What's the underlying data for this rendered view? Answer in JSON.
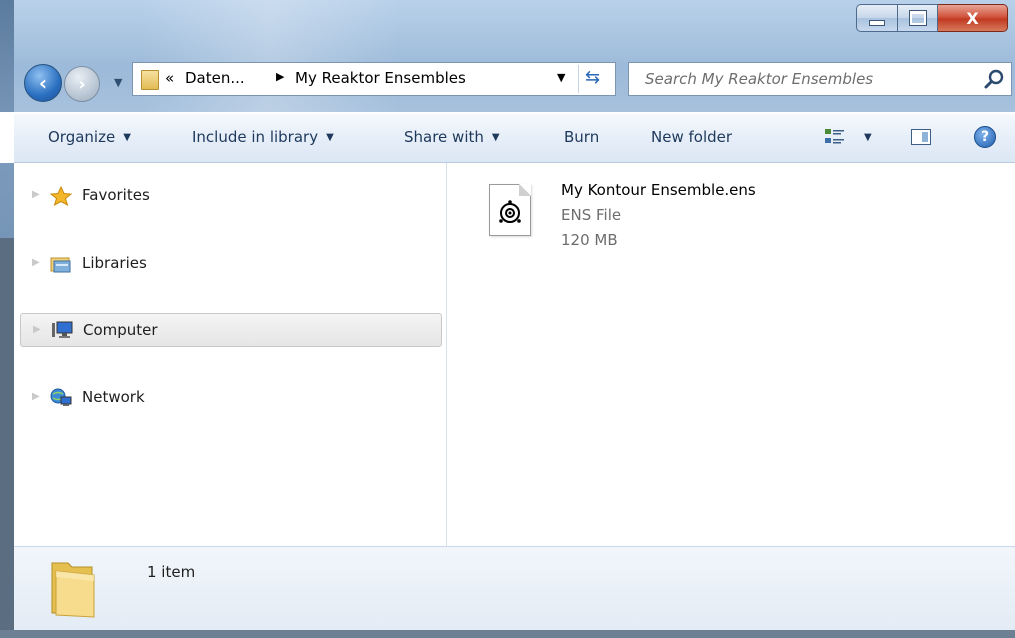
{
  "window": {
    "controls": {
      "minimize": "",
      "maximize": "",
      "close": "X"
    }
  },
  "nav": {
    "back": "‹",
    "forward": "›",
    "breadcrumb": {
      "overflow": "«",
      "parent": "Daten...",
      "current": "My Reaktor Ensembles"
    },
    "search_placeholder": "Search My Reaktor Ensembles"
  },
  "toolbar": {
    "organize": "Organize",
    "include_in_library": "Include in library",
    "share_with": "Share with",
    "burn": "Burn",
    "new_folder": "New folder"
  },
  "sidebar": {
    "items": [
      {
        "label": "Favorites",
        "icon": "star-icon"
      },
      {
        "label": "Libraries",
        "icon": "library-icon"
      },
      {
        "label": "Computer",
        "icon": "computer-icon",
        "selected": true
      },
      {
        "label": "Network",
        "icon": "network-icon"
      }
    ]
  },
  "files": [
    {
      "name": "My Kontour Ensemble.ens",
      "type": "ENS File",
      "size": "120 MB",
      "icon": "ens-file-icon"
    }
  ],
  "details": {
    "item_count": "1 item"
  },
  "colors": {
    "accent": "#1e395b",
    "glass": "#a9c4e0",
    "close": "#c13a22"
  }
}
